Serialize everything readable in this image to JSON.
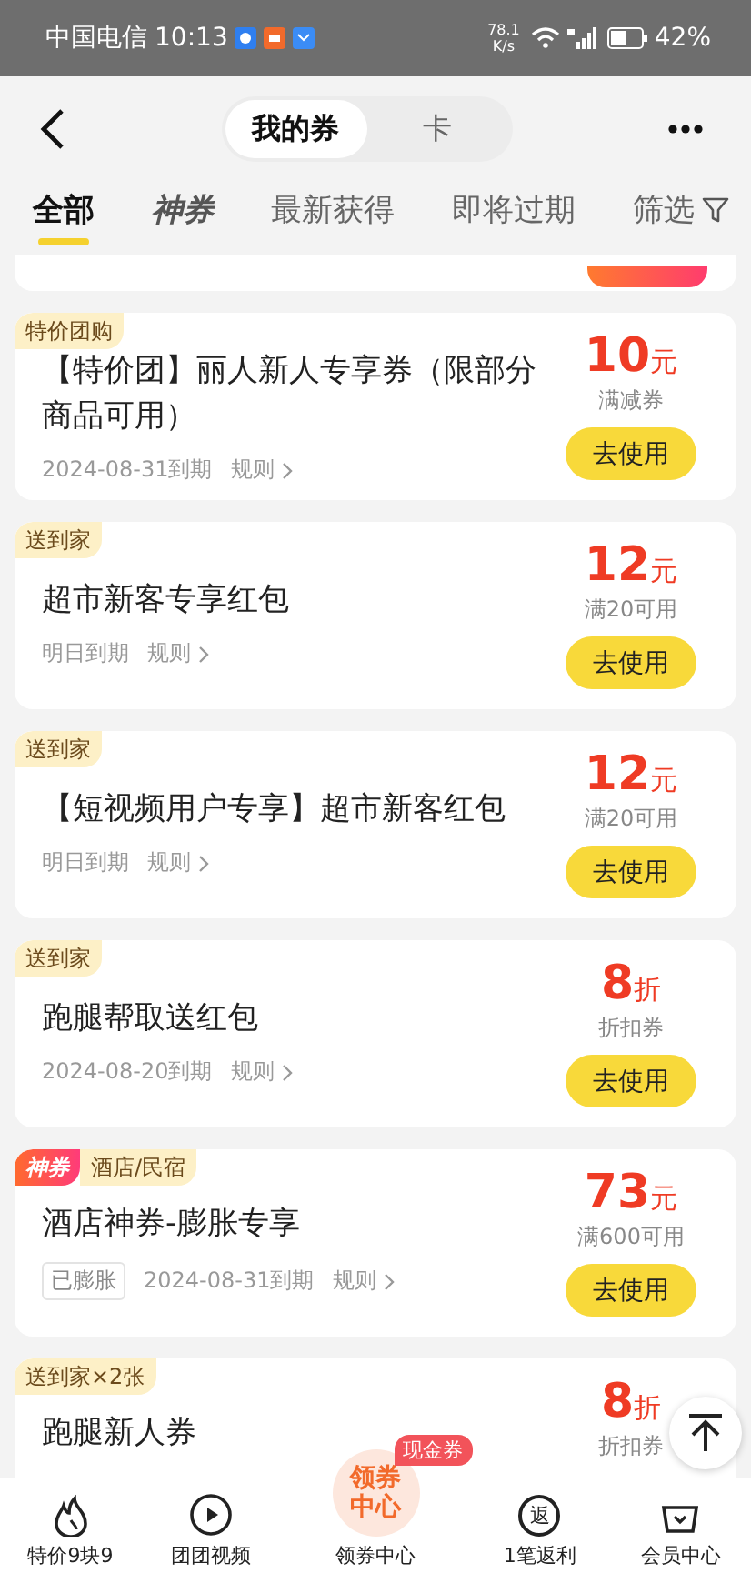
{
  "status_bar": {
    "carrier": "中国电信",
    "time": "10:13",
    "speed": "78.1",
    "speed_unit": "K/s",
    "battery": "42%"
  },
  "header": {
    "segments": [
      {
        "label": "我的券",
        "selected": true
      },
      {
        "label": "卡",
        "selected": false
      }
    ]
  },
  "tabs": [
    {
      "label": "全部",
      "kind": "plain",
      "selected": true
    },
    {
      "label": "神券",
      "kind": "brand",
      "selected": false
    },
    {
      "label": "最新获得",
      "kind": "plain",
      "selected": false
    },
    {
      "label": "即将过期",
      "kind": "plain",
      "selected": false
    },
    {
      "label": "筛选",
      "kind": "filter",
      "selected": false
    }
  ],
  "coupons": [
    {
      "tags": [
        {
          "text": "特价团购",
          "kind": "normal"
        }
      ],
      "title": "【特价团】丽人新人专享券（限部分商品可用）",
      "expiry": "2024-08-31到期",
      "rules": "规则",
      "amount": "10",
      "unit": "元",
      "condition": "满减券",
      "button": "去使用"
    },
    {
      "tags": [
        {
          "text": "送到家",
          "kind": "normal"
        }
      ],
      "title": "超市新客专享红包",
      "expiry": "明日到期",
      "rules": "规则",
      "amount": "12",
      "unit": "元",
      "condition": "满20可用",
      "button": "去使用"
    },
    {
      "tags": [
        {
          "text": "送到家",
          "kind": "normal"
        }
      ],
      "title": "【短视频用户专享】超市新客红包",
      "expiry": "明日到期",
      "rules": "规则",
      "amount": "12",
      "unit": "元",
      "condition": "满20可用",
      "button": "去使用"
    },
    {
      "tags": [
        {
          "text": "送到家",
          "kind": "normal"
        }
      ],
      "title": "跑腿帮取送红包",
      "expiry": "2024-08-20到期",
      "rules": "规则",
      "amount": "8",
      "unit": "折",
      "condition": "折扣券",
      "button": "去使用"
    },
    {
      "tags": [
        {
          "text": "神券",
          "kind": "hot"
        },
        {
          "text": "酒店/民宿",
          "kind": "normal"
        }
      ],
      "badge": "已膨胀",
      "title": "酒店神券-膨胀专享",
      "expiry": "2024-08-31到期",
      "rules": "规则",
      "amount": "73",
      "unit": "元",
      "condition": "满600可用",
      "button": "去使用"
    },
    {
      "tags": [
        {
          "text": "送到家×2张",
          "kind": "normal"
        }
      ],
      "title": "跑腿新人券",
      "amount": "8",
      "unit": "折",
      "condition": "折扣券"
    }
  ],
  "bottom_nav": [
    {
      "label": "特价9块9"
    },
    {
      "label": "团团视频"
    },
    {
      "label": "领券中心",
      "center_text": "领券中心",
      "badge": "现金券"
    },
    {
      "label": "1笔返利",
      "icon_text": "返"
    },
    {
      "label": "会员中心"
    }
  ]
}
